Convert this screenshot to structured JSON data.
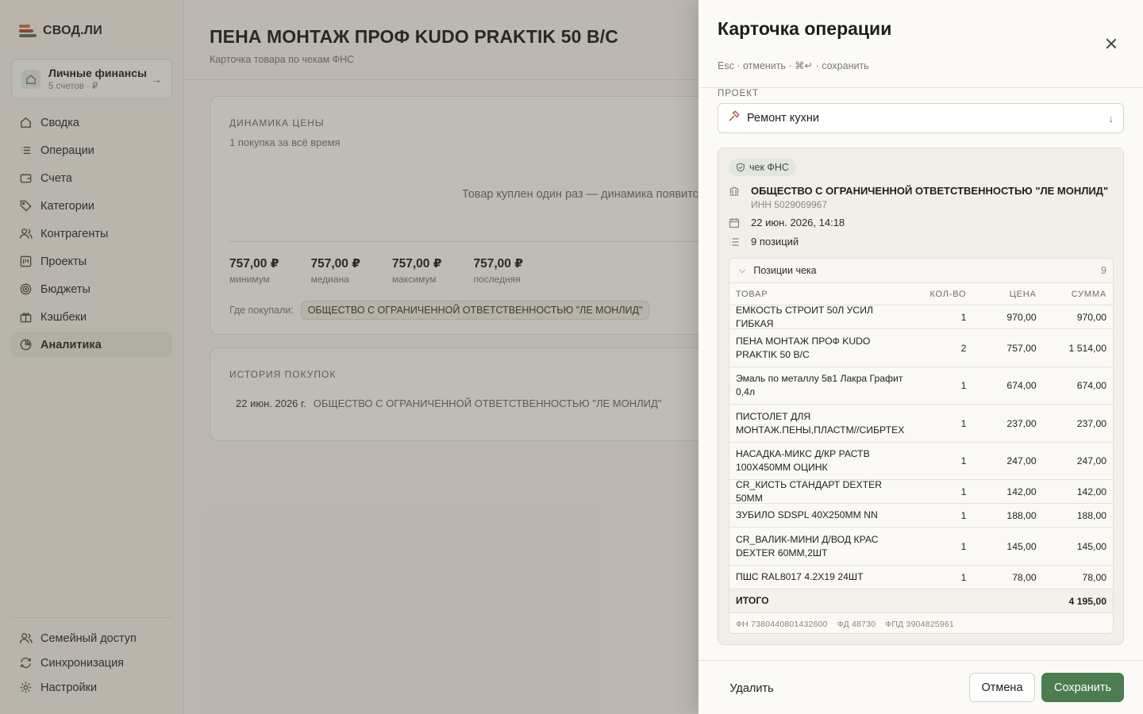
{
  "app": {
    "logo_text": "СВОД.ЛИ"
  },
  "workspace": {
    "title": "Личные финансы",
    "subtitle": "5 счетов · ₽"
  },
  "nav": [
    {
      "label": "Сводка",
      "icon": "home-icon"
    },
    {
      "label": "Операции",
      "icon": "list-icon"
    },
    {
      "label": "Счета",
      "icon": "wallet-icon"
    },
    {
      "label": "Категории",
      "icon": "tag-icon"
    },
    {
      "label": "Контрагенты",
      "icon": "users-icon"
    },
    {
      "label": "Проекты",
      "icon": "projects-icon"
    },
    {
      "label": "Бюджеты",
      "icon": "target-icon"
    },
    {
      "label": "Кэшбеки",
      "icon": "gift-icon"
    },
    {
      "label": "Аналитика",
      "icon": "pie-chart-icon",
      "active": true
    }
  ],
  "nav_bottom": [
    {
      "label": "Семейный доступ",
      "icon": "family-icon"
    },
    {
      "label": "Синхронизация",
      "icon": "sync-icon"
    },
    {
      "label": "Настройки",
      "icon": "gear-icon"
    }
  ],
  "page": {
    "title": "ПЕНА МОНТАЖ ПРОФ KUDO PRAKTIK 50 В/С",
    "subtitle": "Карточка товара по чекам ФНС",
    "dynamics": {
      "label": "ДИНАМИКА ЦЕНЫ",
      "subtitle": "1 покупка за всё время",
      "empty_text": "Товар куплен один раз — динамика появится после повторной покупки",
      "stats": [
        {
          "value": "757,00 ₽",
          "label": "минимум"
        },
        {
          "value": "757,00 ₽",
          "label": "медиана"
        },
        {
          "value": "757,00 ₽",
          "label": "максимум"
        },
        {
          "value": "757,00 ₽",
          "label": "последняя"
        }
      ],
      "where_label": "Где покупали:",
      "where_value": "ОБЩЕСТВО С ОГРАНИЧЕННОЙ ОТВЕТСТВЕННОСТЬЮ \"ЛЕ МОНЛИД\""
    },
    "history": {
      "label": "ИСТОРИЯ ПОКУПОК",
      "rows": [
        {
          "date": "22 июн. 2026 г.",
          "seller": "ОБЩЕСТВО С ОГРАНИЧЕННОЙ ОТВЕТСТВЕННОСТЬЮ \"ЛЕ МОНЛИД\""
        }
      ]
    }
  },
  "panel": {
    "title": "Карточка операции",
    "hint": "Esc · отменить · ⌘↵ · сохранить",
    "project_label": "ПРОЕКТ",
    "project_value": "Ремонт кухни",
    "badge": "чек ФНС",
    "seller_name": "ОБЩЕСТВО С ОГРАНИЧЕННОЙ ОТВЕТСТВЕННОСТЬЮ \"ЛЕ МОНЛИД\"",
    "seller_inn": "ИНН 5029069967",
    "datetime": "22 июн. 2026, 14:18",
    "positions_count": "9 позиций",
    "items_title": "Позиции чека",
    "items_count": "9",
    "columns": {
      "name": "ТОВАР",
      "qty": "КОЛ-ВО",
      "price": "ЦЕНА",
      "sum": "СУММА"
    },
    "items": [
      {
        "name": "ЕМКОСТЬ СТРОИТ 50Л УСИЛ ГИБКАЯ",
        "qty": "1",
        "price": "970,00",
        "sum": "970,00"
      },
      {
        "name": "ПЕНА МОНТАЖ ПРОФ KUDO PRAKTIK 50 В/С",
        "qty": "2",
        "price": "757,00",
        "sum": "1 514,00"
      },
      {
        "name": "Эмаль по металлу 5в1 Лакра Графит 0,4л",
        "qty": "1",
        "price": "674,00",
        "sum": "674,00"
      },
      {
        "name": "ПИСТОЛЕТ ДЛЯ МОНТАЖ.ПЕНЫ,ПЛАСТМ//СИБРТЕХ",
        "qty": "1",
        "price": "237,00",
        "sum": "237,00"
      },
      {
        "name": "НАСАДКА-МИКС Д/КР РАСТВ 100Х450ММ ОЦИНК",
        "qty": "1",
        "price": "247,00",
        "sum": "247,00"
      },
      {
        "name": "CR_КИСТЬ СТАНДАРТ DEXTER 50ММ",
        "qty": "1",
        "price": "142,00",
        "sum": "142,00"
      },
      {
        "name": "ЗУБИЛО SDSPL 40X250MM NN",
        "qty": "1",
        "price": "188,00",
        "sum": "188,00"
      },
      {
        "name": "CR_ВАЛИК-МИНИ Д/ВОД КРАС DEXTER 60ММ,2ШТ",
        "qty": "1",
        "price": "145,00",
        "sum": "145,00"
      },
      {
        "name": "ПШС RAL8017 4.2X19 24ШТ",
        "qty": "1",
        "price": "78,00",
        "sum": "78,00"
      }
    ],
    "total_label": "ИТОГО",
    "total_value": "4 195,00",
    "fiscal": {
      "fn": "ФН 7380440801432600",
      "fd": "ФД 48730",
      "fpd": "ФПД 3904825961"
    },
    "buttons": {
      "delete": "Удалить",
      "cancel": "Отмена",
      "save": "Сохранить"
    }
  },
  "colors": {
    "accent": "#4b7d4f",
    "nav_active_bg": "#e0e5db"
  }
}
